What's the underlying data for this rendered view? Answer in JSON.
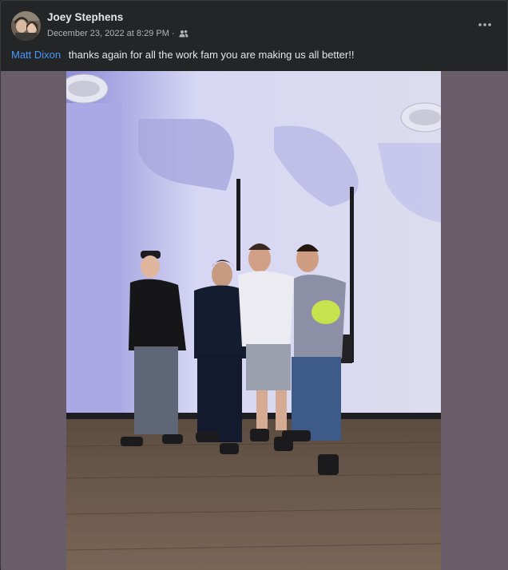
{
  "post": {
    "author": "Joey Stephens",
    "timestamp": "December 23, 2022 at 8:29 PM",
    "separator": "·",
    "audience_icon": "friends-icon",
    "more_icon": "more-options-icon",
    "mention": "Matt Dixon",
    "text": "thanks again for all the work fam you are making us all better!!"
  },
  "media": {
    "type": "photo",
    "subject": "four men posing arm in arm in a gym"
  },
  "colors": {
    "background": "#242526",
    "mention": "#4599ff",
    "media_backdrop": "#6a5d6a",
    "text_primary": "#e4e6eb",
    "text_secondary": "#b0b3b8"
  }
}
